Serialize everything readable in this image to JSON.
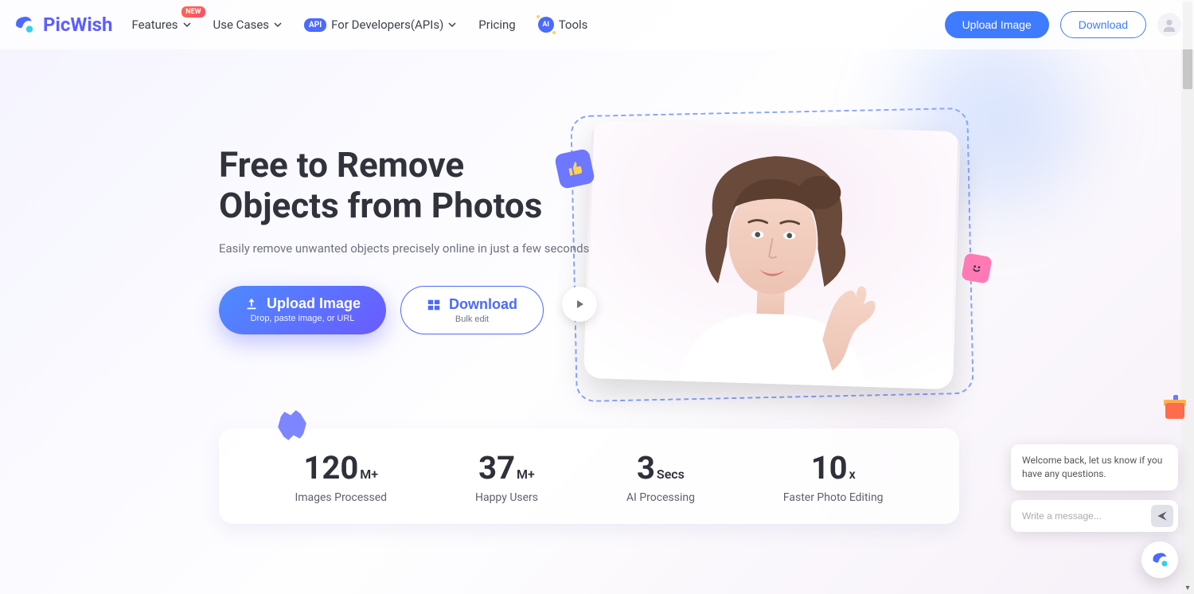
{
  "brand": {
    "name": "PicWish"
  },
  "nav": {
    "features": "Features",
    "usecases": "Use Cases",
    "api": "For Developers(APIs)",
    "pricing": "Pricing",
    "tools": "Tools",
    "new_badge": "NEW",
    "api_chip": "API",
    "ai_chip": "AI",
    "upload": "Upload Image",
    "download": "Download"
  },
  "hero": {
    "title_line1": "Free to Remove",
    "title_line2": "Objects from Photos",
    "subtitle": "Easily remove unwanted objects precisely online in just a few seconds",
    "upload_main": "Upload Image",
    "upload_sub": "Drop, paste image, or URL",
    "download_main": "Download",
    "download_sub": "Bulk edit"
  },
  "stats": [
    {
      "value": "120",
      "unit": "M+",
      "label": "Images Processed"
    },
    {
      "value": "37",
      "unit": "M+",
      "label": "Happy Users"
    },
    {
      "value": "3",
      "unit": "Secs",
      "label": "AI Processing"
    },
    {
      "value": "10",
      "unit": "x",
      "label": "Faster Photo Editing"
    }
  ],
  "chat": {
    "welcome": "Welcome back, let us know if you have any questions.",
    "placeholder": "Write a message..."
  }
}
